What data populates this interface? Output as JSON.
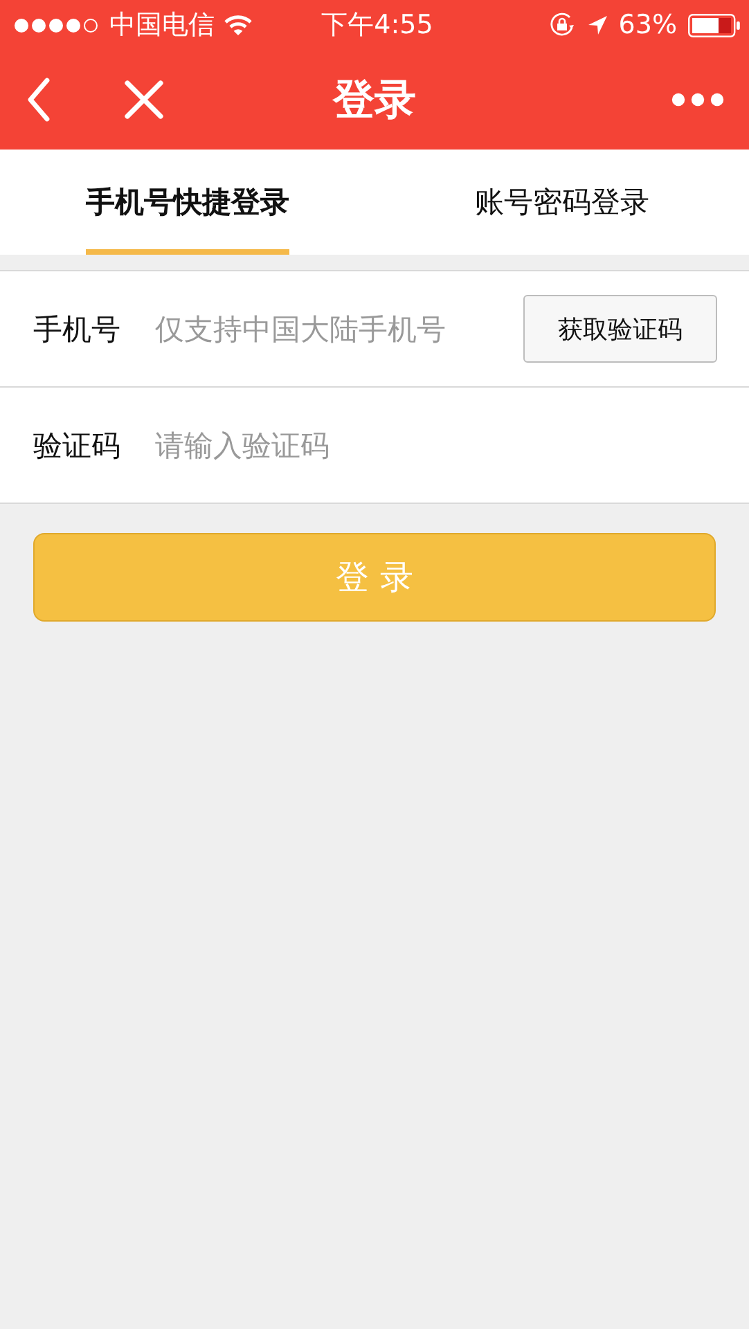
{
  "status_bar": {
    "carrier": "中国电信",
    "time": "下午4:55",
    "battery": "63%"
  },
  "nav": {
    "title": "登录"
  },
  "tabs": [
    {
      "label": "手机号快捷登录",
      "selected": true
    },
    {
      "label": "账号密码登录",
      "selected": false
    }
  ],
  "form": {
    "fields": [
      {
        "label": "手机号",
        "placeholder": "仅支持中国大陆手机号",
        "button": "获取验证码"
      },
      {
        "label": "验证码",
        "placeholder": "请输入验证码"
      }
    ],
    "submit": "登 录"
  }
}
